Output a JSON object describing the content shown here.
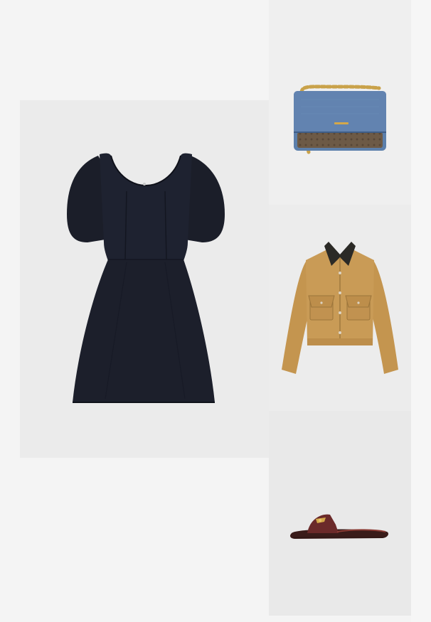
{
  "board": {
    "items": [
      {
        "id": "dress",
        "icon": "black-puff-sleeve-dress-image"
      },
      {
        "id": "bag",
        "icon": "denim-chain-shoulder-bag-image"
      },
      {
        "id": "jacket",
        "icon": "tan-suede-cropped-jacket-image"
      },
      {
        "id": "sandal",
        "icon": "burgundy-slide-sandal-image"
      }
    ]
  },
  "colors": {
    "page_background": "#f4f4f4",
    "dress": "#1c1f2b",
    "bag_denim": "#5b7fae",
    "bag_chain": "#c9a24a",
    "jacket": "#c79a55",
    "jacket_collar": "#2b2a26",
    "sandal": "#6b2a2a",
    "hardware_gold": "#d4a84a"
  }
}
